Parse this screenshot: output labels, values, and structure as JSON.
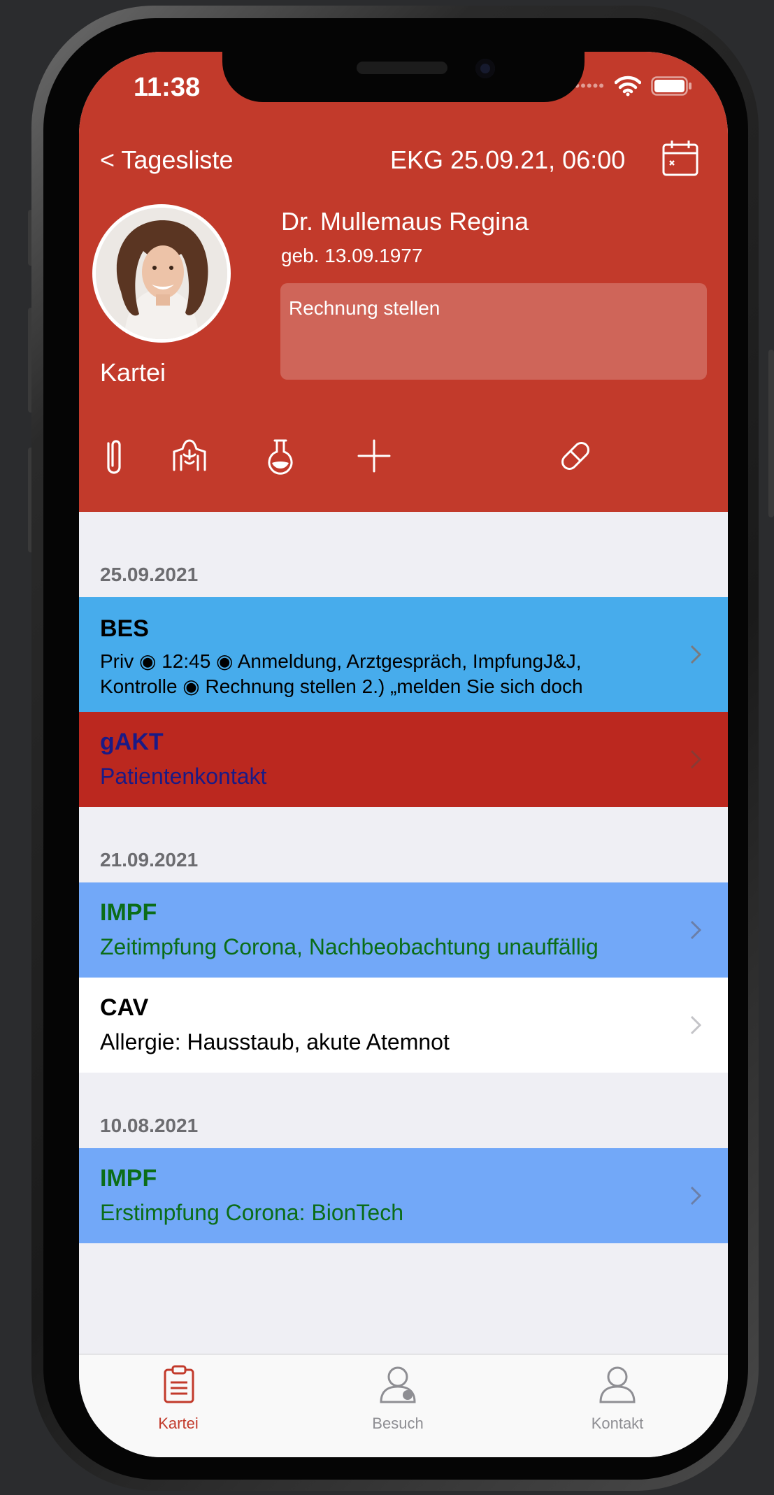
{
  "status": {
    "time": "11:38"
  },
  "nav": {
    "back_label": "< Tagesliste",
    "title": "EKG 25.09.21, 06:00"
  },
  "patient": {
    "name": "Dr. Mullemaus Regina",
    "birth": "geb. 13.09.1977",
    "avatar_label": "Kartei",
    "note": "Rechnung stellen"
  },
  "toolbar": {
    "icons": [
      "paperclip-icon",
      "body-icon",
      "lab-flask-icon",
      "add-icon",
      "pill-icon"
    ]
  },
  "sections": [
    {
      "date": "25.09.2021",
      "rows": [
        {
          "title": "BES",
          "sub1": "Priv ◉ 12:45 ◉ Anmeldung, Arztgespräch, ImpfungJ&J,",
          "sub2": "Kontrolle ◉ Rechnung stellen    2.) „melden Sie sich doch",
          "bg": "#47acec",
          "color": "#000000"
        },
        {
          "title": "gAKT",
          "sub1": "Patientenkontakt",
          "bg": "#bb281f",
          "color": "#1a1a86"
        }
      ]
    },
    {
      "date": "21.09.2021",
      "rows": [
        {
          "title": "IMPF",
          "sub1": "Zeitimpfung Corona, Nachbeobachtung unauffällig",
          "bg": "#72a8f8",
          "color": "#0b6d18"
        },
        {
          "title": "CAV",
          "sub1": "Allergie: Hausstaub, akute Atemnot",
          "bg": "#ffffff",
          "color": "#000000"
        }
      ]
    },
    {
      "date": "10.08.2021",
      "rows": [
        {
          "title": "IMPF",
          "sub1": "Erstimpfung Corona: BionTech",
          "bg": "#72a8f8",
          "color": "#0b6d18"
        }
      ]
    }
  ],
  "tabbar": {
    "tabs": [
      {
        "label": "Kartei",
        "icon": "clipboard-icon",
        "active": true
      },
      {
        "label": "Besuch",
        "icon": "visit-person-icon",
        "active": false
      },
      {
        "label": "Kontakt",
        "icon": "contact-person-icon",
        "active": false
      }
    ],
    "active_color": "#c23a2b",
    "inactive_color": "#8e8e93"
  },
  "colors": {
    "header": "#c23a2b",
    "background": "#efeff4"
  }
}
